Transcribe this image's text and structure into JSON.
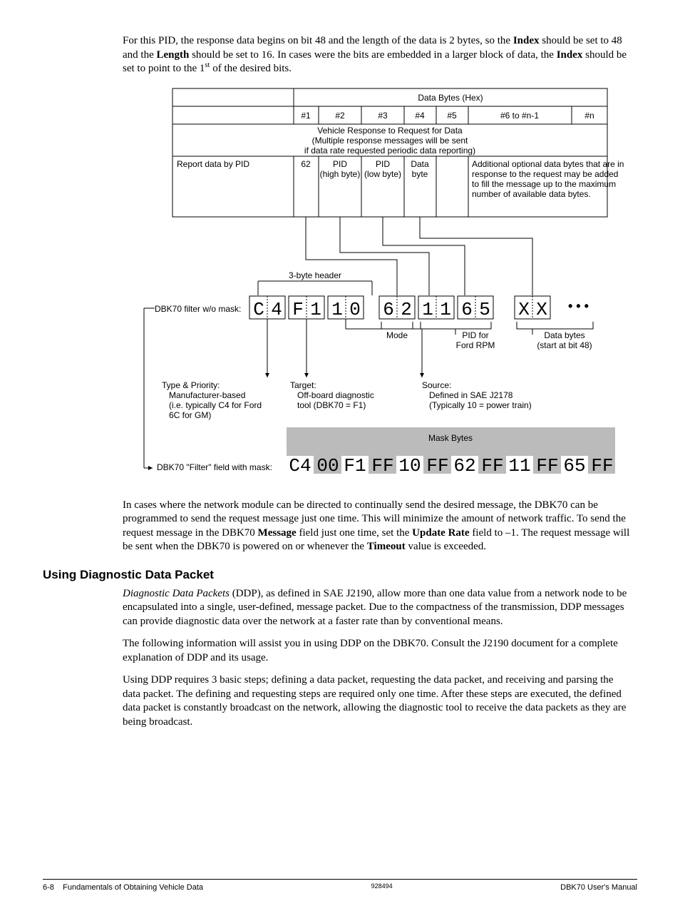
{
  "para1_a": "For this PID, the response data begins on bit 48 and the length of the data is 2 bytes, so the ",
  "para1_b": "Index",
  "para1_c": " should be set to 48 and the ",
  "para1_d": "Length",
  "para1_e": " should be set to 16. In cases were the bits are embedded in a larger block of data, the ",
  "para1_f": "Index",
  "para1_g": " should be set to point to the 1",
  "para1_h": "st",
  "para1_i": " of the desired bits.",
  "diagram": {
    "hdr_databytes": "Data Bytes (Hex)",
    "hdr_cols": [
      "#1",
      "#2",
      "#3",
      "#4",
      "#5",
      "#6 to #n-1",
      "#n"
    ],
    "vehicle_resp_l1": "Vehicle Response to Request for Data",
    "vehicle_resp_l2": "(Multiple response messages will be sent",
    "vehicle_resp_l3": "if data rate requested periodic data reporting)",
    "report_by_pid": "Report data by PID",
    "cell_62": "62",
    "cell_pid_hi_1": "PID",
    "cell_pid_hi_2": "(high byte)",
    "cell_pid_lo_1": "PID",
    "cell_pid_lo_2": "(low byte)",
    "cell_data_1": "Data",
    "cell_data_2": "byte",
    "cell_add_1": "Additional optional data bytes that are in",
    "cell_add_2": "response to the request may be added",
    "cell_add_3": "to fill the message up to the maximum",
    "cell_add_4": "number of available data bytes.",
    "label_3byte": "3-byte header",
    "label_filter_no_mask": "DBK70 filter w/o mask:",
    "bytes": [
      "C",
      "4",
      "F",
      "1",
      "1",
      "0",
      "6",
      "2",
      "1",
      "1",
      "6",
      "5",
      "X",
      "X"
    ],
    "dots": "• • •",
    "label_mode": "Mode",
    "label_pid_for": "PID for",
    "label_ford_rpm": "Ford RPM",
    "label_databytes_l1": "Data bytes",
    "label_databytes_l2": "(start at bit 48)",
    "tp_l1": "Type & Priority:",
    "tp_l2": "Manufacturer-based",
    "tp_l3": "(i.e. typically C4 for Ford",
    "tp_l4": "6C for GM)",
    "tgt_l1": "Target:",
    "tgt_l2": "Off-board diagnostic",
    "tgt_l3": "tool (DBK70 = F1)",
    "src_l1": "Source:",
    "src_l2": "Defined in SAE J2178",
    "src_l3": "(Typically 10 = power train)",
    "mask_bytes_label": "Mask Bytes",
    "filter_with_mask": "DBK70 \"Filter\" field with mask:",
    "mask_string": [
      "C4",
      "00",
      "F1",
      "FF",
      "10",
      "FF",
      "62",
      "FF",
      "11",
      "FF",
      "65",
      "FF"
    ]
  },
  "para2_a": "In cases where the network module can be directed to continually send the desired message, the DBK70 can be programmed to send the request message just one time. This will minimize the amount of network traffic. To send the request message in the DBK70 ",
  "para2_b": "Message",
  "para2_c": " field just one time, set the ",
  "para2_d": "Update Rate",
  "para2_e": " field to –1. The request message will be sent when the DBK70 is powered on or whenever the ",
  "para2_f": "Timeout",
  "para2_g": " value is exceeded.",
  "heading2": "Using Diagnostic Data Packet",
  "para3_a": "Diagnostic Data Packets",
  "para3_b": " (DDP), as defined in SAE J2190, allow more than one data value from a network node to be encapsulated into a single, user-defined, message packet. Due to the compactness of the transmission, DDP messages can provide diagnostic data over the network at a faster rate than by conventional means.",
  "para4": "The following information will assist you in using DDP on the DBK70. Consult the J2190 document for a complete explanation of DDP and its usage.",
  "para5": "Using DDP requires 3 basic steps; defining a data packet, requesting the data packet, and receiving and parsing the data packet. The defining and requesting steps are required only one time. After these steps are executed, the defined data packet is constantly broadcast on the network, allowing the diagnostic tool to receive the data packets as they are being broadcast.",
  "footer_left_a": "6-8",
  "footer_left_b": "Fundamentals of Obtaining Vehicle Data",
  "footer_center": "928494",
  "footer_right": "DBK70 User's Manual"
}
